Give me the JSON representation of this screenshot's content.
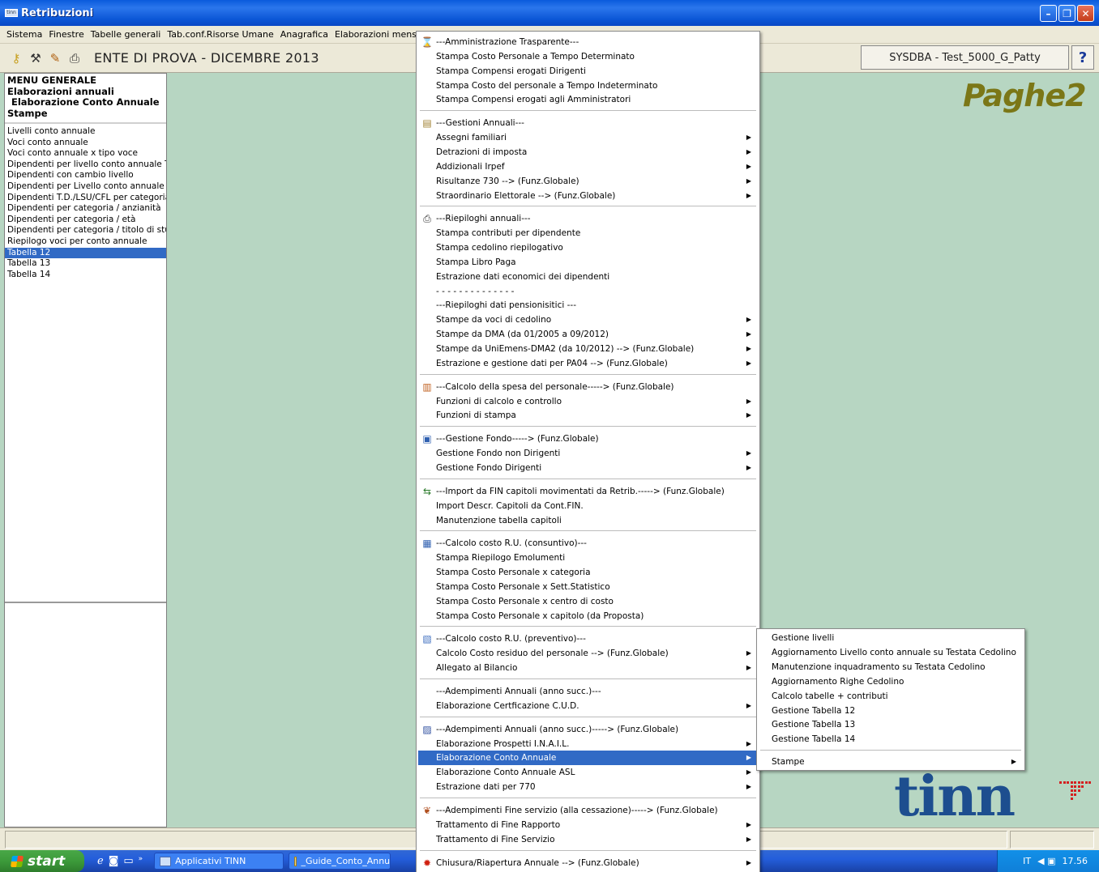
{
  "window": {
    "title": "Retribuzioni",
    "icon": "tinn-app-icon"
  },
  "menubar": [
    "Sistema",
    "Finestre",
    "Tabelle generali",
    "Tab.conf.Risorse Umane",
    "Anagrafica",
    "Elaborazioni mensili"
  ],
  "toolbar": {
    "icons": [
      "key-icon",
      "tools-icon",
      "pencil-icon",
      "printer-icon"
    ],
    "ente": "ENTE DI PROVA - DICEMBRE 2013",
    "user": "SYSDBA - Test_5000_G_Patty",
    "help": "?"
  },
  "left": {
    "crumbs": [
      "MENU GENERALE",
      "Elaborazioni annuali",
      "Elaborazione Conto Annuale",
      "Stampe"
    ],
    "items": [
      "Livelli conto annuale",
      "Voci conto annuale",
      "Voci conto annuale x tipo voce",
      "Dipendenti per livello conto annuale Te",
      "Dipendenti con cambio livello",
      "Dipendenti per Livello conto annuale Ri",
      "Dipendenti T.D./LSU/CFL per categoria",
      "Dipendenti per categoria / anzianità",
      "Dipendenti per categoria / età",
      "Dipendenti per categoria / titolo di studi",
      "Riepilogo voci per conto annuale",
      "Tabella 12",
      "Tabella 13",
      "Tabella 14"
    ],
    "selected_index": 11
  },
  "brand": {
    "paghe": "Paghe2",
    "tinn": "tinn"
  },
  "menu": [
    {
      "label": "---Amministrazione Trasparente---",
      "icon": "hourglass-icon",
      "top": 0
    },
    {
      "label": "Stampa Costo Personale a Tempo Determinato"
    },
    {
      "label": "Stampa Compensi erogati Dirigenti"
    },
    {
      "label": "Stampa Costo del personale a Tempo Indeterminato"
    },
    {
      "label": "Stampa Compensi erogati agli Amministratori"
    },
    {
      "sep": true
    },
    {
      "label": "---Gestioni Annuali---",
      "icon": "calendar-icon"
    },
    {
      "label": "Assegni familiari",
      "sub": true
    },
    {
      "label": "Detrazioni di imposta",
      "sub": true
    },
    {
      "label": "Addizionali Irpef",
      "sub": true
    },
    {
      "label": "Risultanze 730 --> (Funz.Globale)",
      "sub": true
    },
    {
      "label": "Straordinario Elettorale --> (Funz.Globale)",
      "sub": true
    },
    {
      "sep": true
    },
    {
      "label": "---Riepiloghi annuali---",
      "icon": "printer-icon"
    },
    {
      "label": "Stampa contributi per dipendente"
    },
    {
      "label": "Stampa cedolino riepilogativo"
    },
    {
      "label": "Stampa Libro Paga"
    },
    {
      "label": "Estrazione dati economici dei dipendenti"
    },
    {
      "label": "  - - - - - - - - - - - - - -"
    },
    {
      "label": "---Riepiloghi dati pensionisitici ---"
    },
    {
      "label": "Stampe da voci di cedolino",
      "sub": true
    },
    {
      "label": "Stampe da DMA (da 01/2005 a 09/2012)",
      "sub": true
    },
    {
      "label": "Stampe da UniEmens-DMA2 (da 10/2012)  --> (Funz.Globale)",
      "sub": true
    },
    {
      "label": "Estrazione e gestione dati per PA04  --> (Funz.Globale)",
      "sub": true
    },
    {
      "sep": true
    },
    {
      "label": "---Calcolo della spesa del personale-----> (Funz.Globale)",
      "icon": "chart-icon"
    },
    {
      "label": "Funzioni di calcolo e controllo",
      "sub": true
    },
    {
      "label": "Funzioni di stampa",
      "sub": true
    },
    {
      "sep": true
    },
    {
      "label": "---Gestione Fondo-----> (Funz.Globale)",
      "icon": "fund-icon"
    },
    {
      "label": "Gestione Fondo non Dirigenti",
      "sub": true
    },
    {
      "label": "Gestione Fondo Dirigenti",
      "sub": true
    },
    {
      "sep": true
    },
    {
      "label": "---Import da FIN capitoli movimentati da Retrib.-----> (Funz.Globale)",
      "icon": "import-icon"
    },
    {
      "label": "Import Descr. Capitoli da Cont.FIN."
    },
    {
      "label": "Manutenzione tabella capitoli"
    },
    {
      "sep": true
    },
    {
      "label": "---Calcolo costo R.U. (consuntivo)---",
      "icon": "sheet-icon"
    },
    {
      "label": "Stampa Riepilogo Emolumenti"
    },
    {
      "label": "Stampa Costo Personale x categoria"
    },
    {
      "label": "Stampa Costo Personale x Sett.Statistico"
    },
    {
      "label": "Stampa Costo Personale x centro di costo"
    },
    {
      "label": "Stampa Costo Personale x capitolo (da Proposta)"
    },
    {
      "sep": true
    },
    {
      "label": "---Calcolo costo R.U. (preventivo)---",
      "icon": "calc-icon"
    },
    {
      "label": "Calcolo Costo residuo del personale --> (Funz.Globale)",
      "sub": true
    },
    {
      "label": "Allegato al Bilancio",
      "sub": true
    },
    {
      "sep": true
    },
    {
      "label": "---Adempimenti Annuali (anno succ.)---"
    },
    {
      "label": "Elaborazione Certficazione C.U.D.",
      "sub": true
    },
    {
      "sep": true
    },
    {
      "label": "---Adempimenti Annuali (anno succ.)-----> (Funz.Globale)",
      "icon": "doc-icon"
    },
    {
      "label": "Elaborazione Prospetti I.N.A.I.L.",
      "sub": true
    },
    {
      "label": "Elaborazione Conto Annuale",
      "sub": true,
      "hl": true
    },
    {
      "label": "Elaborazione Conto Annuale ASL",
      "sub": true
    },
    {
      "label": "Estrazione dati per 770",
      "sub": true
    },
    {
      "sep": true
    },
    {
      "label": "---Adempimenti Fine servizio (alla cessazione)-----> (Funz.Globale)",
      "icon": "leaf-icon"
    },
    {
      "label": "Trattamento di Fine Rapporto",
      "sub": true
    },
    {
      "label": "Trattamento di Fine Servizio",
      "sub": true
    },
    {
      "sep": true
    },
    {
      "label": "Chiusura/Riapertura Annuale --> (Funz.Globale)",
      "icon": "lock-icon",
      "sub": true
    }
  ],
  "submenu": [
    {
      "label": "Gestione livelli"
    },
    {
      "label": "Aggiornamento Livello conto annuale su Testata Cedolino"
    },
    {
      "label": "Manutenzione inquadramento su Testata Cedolino"
    },
    {
      "label": "Aggiornamento Righe Cedolino"
    },
    {
      "label": "Calcolo tabelle + contributi"
    },
    {
      "label": "Gestione Tabella 12"
    },
    {
      "label": "Gestione Tabella 13"
    },
    {
      "label": "Gestione Tabella 14"
    },
    {
      "sep": true
    },
    {
      "label": "Stampe",
      "sub": true
    }
  ],
  "taskbar": {
    "start": "start",
    "items": [
      "Applicativi TINN",
      "_Guide_Conto_Annu"
    ],
    "tray_lang": "IT",
    "clock": "17.56"
  }
}
